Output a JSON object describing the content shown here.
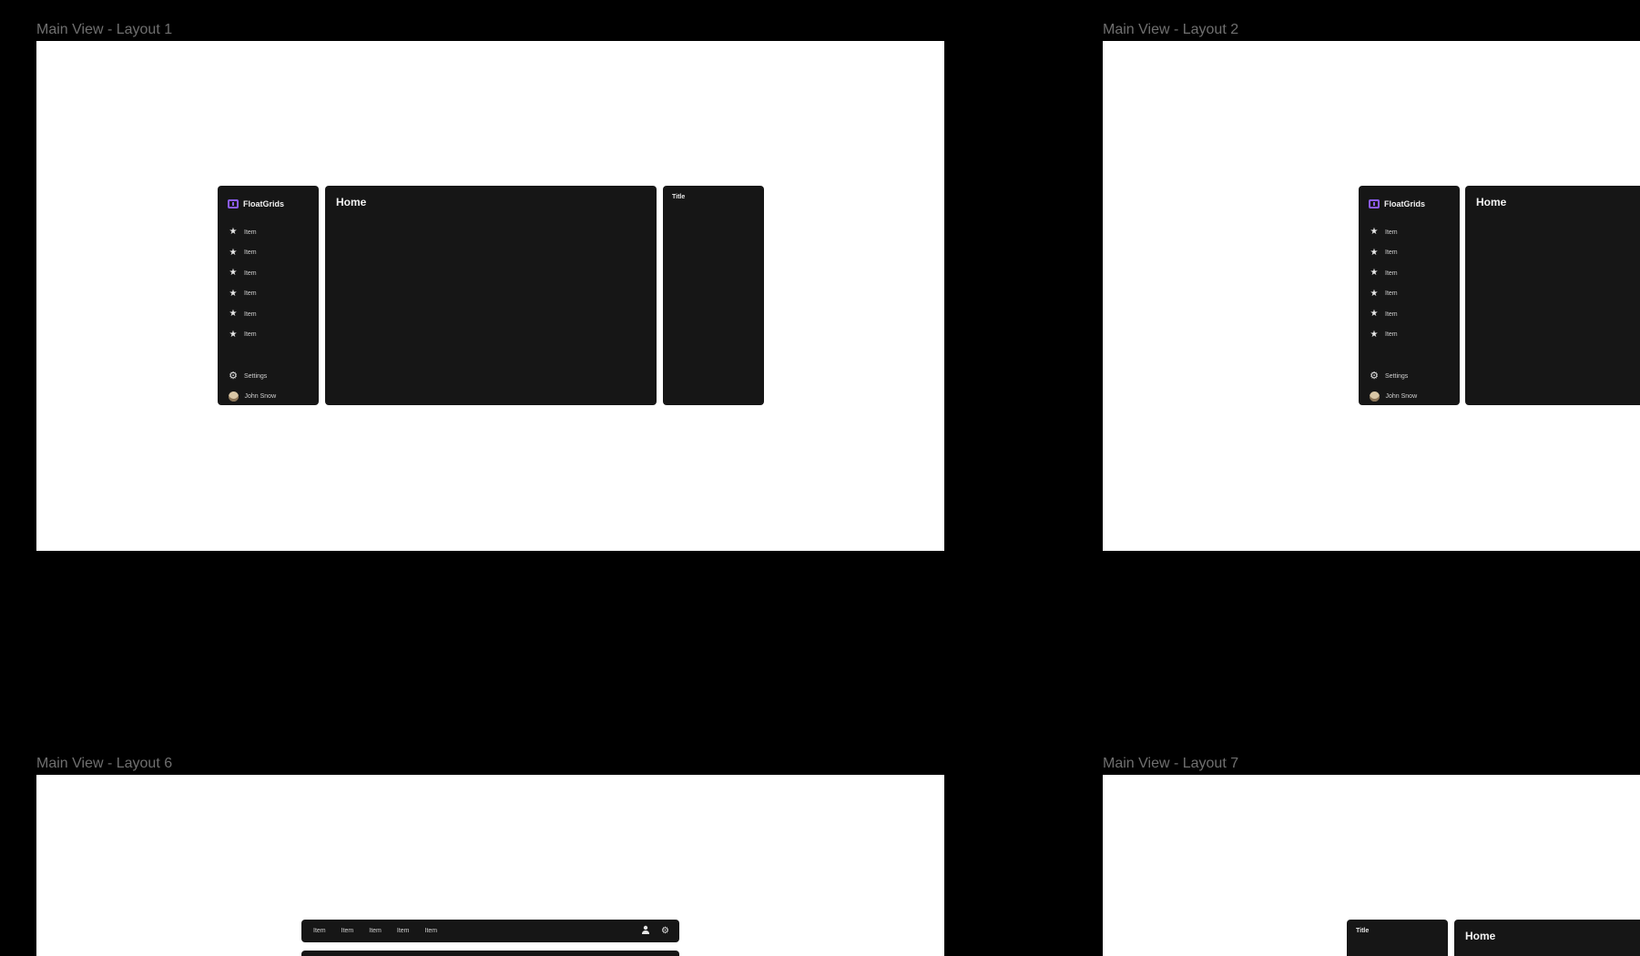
{
  "frames": [
    {
      "label": "Main View - Layout 1",
      "brand": "FloatGrids",
      "nav_items": [
        "Item",
        "Item",
        "Item",
        "Item",
        "Item",
        "Item"
      ],
      "settings_label": "Settings",
      "user_name": "John Snow",
      "main_title": "Home",
      "side_title": "Title"
    },
    {
      "label": "Main View - Layout 2",
      "brand": "FloatGrids",
      "nav_items": [
        "Item",
        "Item",
        "Item",
        "Item",
        "Item",
        "Item"
      ],
      "settings_label": "Settings",
      "user_name": "John Snow",
      "main_title": "Home"
    },
    {
      "label": "Main View - Layout 6",
      "topbar_items": [
        "Item",
        "Item",
        "Item",
        "Item",
        "Item"
      ]
    },
    {
      "label": "Main View - Layout 7",
      "side_title": "Title",
      "main_title": "Home"
    }
  ],
  "icons": {
    "nav": "star-icon",
    "settings": "gear-icon",
    "user": "avatar",
    "brand": "floatgrids-logo-icon",
    "topbar_user": "user-icon",
    "topbar_settings": "gear-icon"
  },
  "colors": {
    "canvas": "#000000",
    "frame": "#ffffff",
    "panel": "#161616",
    "accent": "#8b5cf6",
    "label": "#6f6f6f"
  }
}
